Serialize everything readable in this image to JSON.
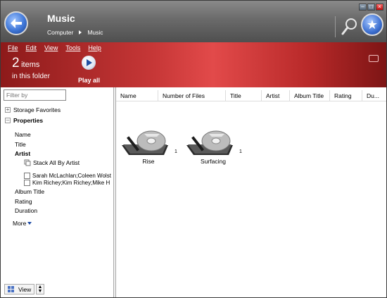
{
  "window": {
    "title": "Music",
    "breadcrumb": [
      "Computer",
      "Music"
    ]
  },
  "menu": [
    "File",
    "Edit",
    "View",
    "Tools",
    "Help"
  ],
  "summary": {
    "count": "2",
    "count_word": "items",
    "count_sub": "in this folder",
    "play_label": "Play all"
  },
  "left": {
    "filter_placeholder": "Filter by",
    "storage_favorites": "Storage Favorites",
    "properties": "Properties",
    "props": [
      "Name",
      "Title",
      "Artist"
    ],
    "stack_label": "Stack All By Artist",
    "artists": [
      "Sarah McLachlan;Coleen Wolst",
      "Kim Richey;Kim Richey;Mike H"
    ],
    "props_after": [
      "Album Title",
      "Rating",
      "Duration"
    ],
    "more": "More",
    "view_label": "View"
  },
  "columns": [
    "Name",
    "Number of Files",
    "Title",
    "Artist",
    "Album Title",
    "Rating",
    "Du..."
  ],
  "items": [
    {
      "label": "Rise",
      "count": "1"
    },
    {
      "label": "Surfacing",
      "count": "1"
    }
  ],
  "colors": {
    "accent_band": "#c73737",
    "title_bar": "#6a6a6a",
    "selection_blue": "#1c49a4"
  }
}
